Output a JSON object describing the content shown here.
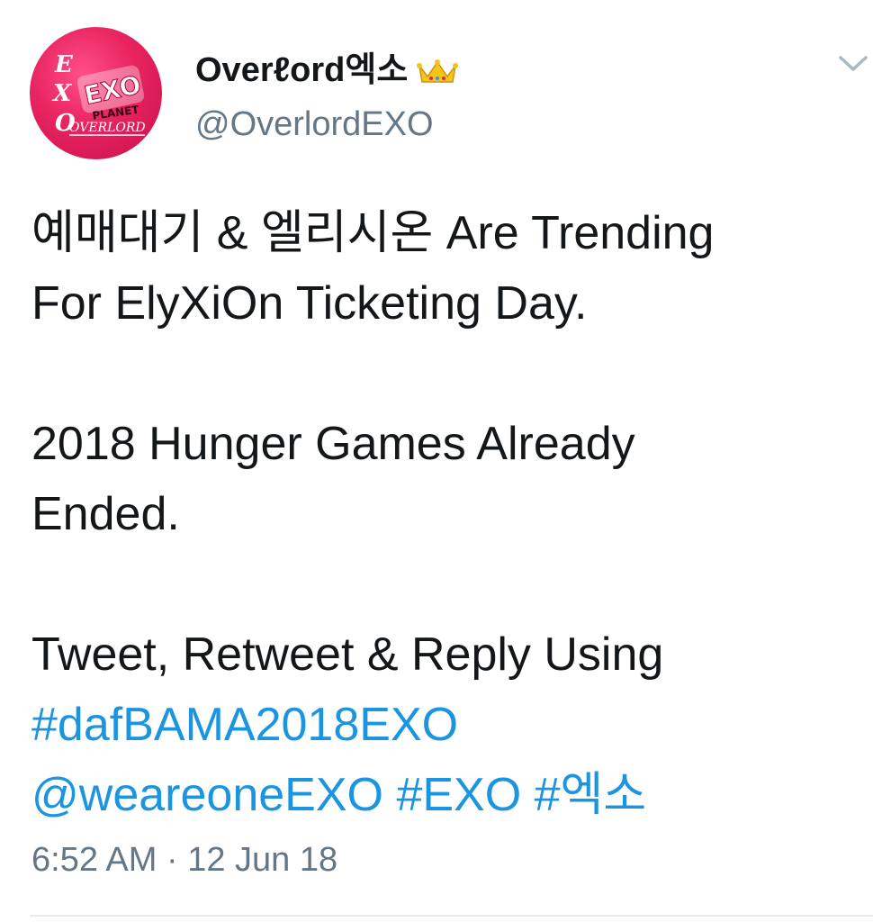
{
  "tweet": {
    "author": {
      "display_name": "Overℓord엑소",
      "handle": "@OverlordEXO",
      "badge_icon": "crown-icon",
      "avatar_text": {
        "letters": [
          "E",
          "X",
          "O"
        ],
        "title": "EXO",
        "subtitle": "PLANET",
        "footer": "OVERLORD"
      }
    },
    "menu_icon": "chevron-down-icon",
    "lines": {
      "l1": "예매대기 & 엘리시온 Are Trending",
      "l2": "For ElyXiOn Ticketing Day.",
      "l3": "2018 Hunger Games Already",
      "l4": "Ended.",
      "l5": "Tweet, Retweet & Reply Using"
    },
    "links": {
      "hashtag_main": "#dafBAMA2018EXO",
      "mention": "@weareoneEXO",
      "hashtag_exo": "#EXO",
      "hashtag_ko": "#엑소"
    },
    "timestamp": "6:52 AM · 12 Jun 18"
  },
  "colors": {
    "text": "#14171a",
    "secondary": "#657786",
    "link": "#1b95e0",
    "avatar_bg": "#e8245f",
    "crown": "#f5c518"
  }
}
